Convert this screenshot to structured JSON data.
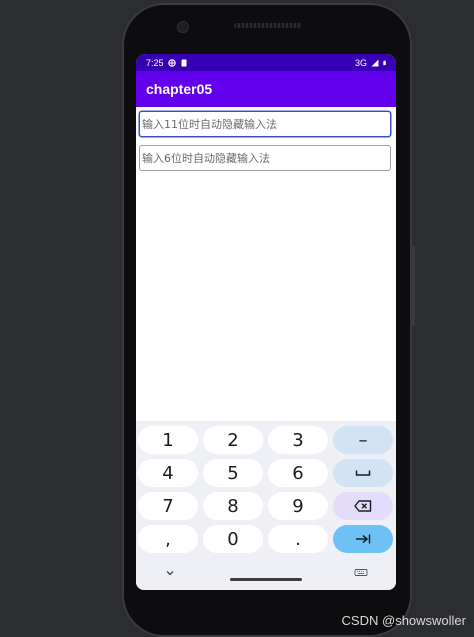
{
  "status_bar": {
    "time": "7:25",
    "network": "3G"
  },
  "app_bar": {
    "title": "chapter05"
  },
  "form": {
    "field1_placeholder": "输入11位时自动隐藏输入法",
    "field2_placeholder": "输入6位时自动隐藏输入法"
  },
  "keyboard": {
    "rows": [
      [
        "1",
        "2",
        "3",
        "–"
      ],
      [
        "4",
        "5",
        "6",
        "space"
      ],
      [
        "7",
        "8",
        "9",
        "backspace"
      ],
      [
        ",",
        "0",
        ".",
        "enter"
      ]
    ],
    "keys": {
      "k1": "1",
      "k2": "2",
      "k3": "3",
      "minus": "–",
      "k4": "4",
      "k5": "5",
      "k6": "6",
      "k7": "7",
      "k8": "8",
      "k9": "9",
      "comma": ",",
      "k0": "0",
      "period": "."
    }
  },
  "watermark": "CSDN @showswoller",
  "colors": {
    "status_bar": "#3700b3",
    "app_bar": "#6200ee",
    "keyboard_bg": "#eef0f6",
    "fn_key": "#d3e3f6",
    "delete_key": "#e4dcfb",
    "enter_key": "#6ec1f5",
    "focus_border": "#3a4bd6"
  }
}
